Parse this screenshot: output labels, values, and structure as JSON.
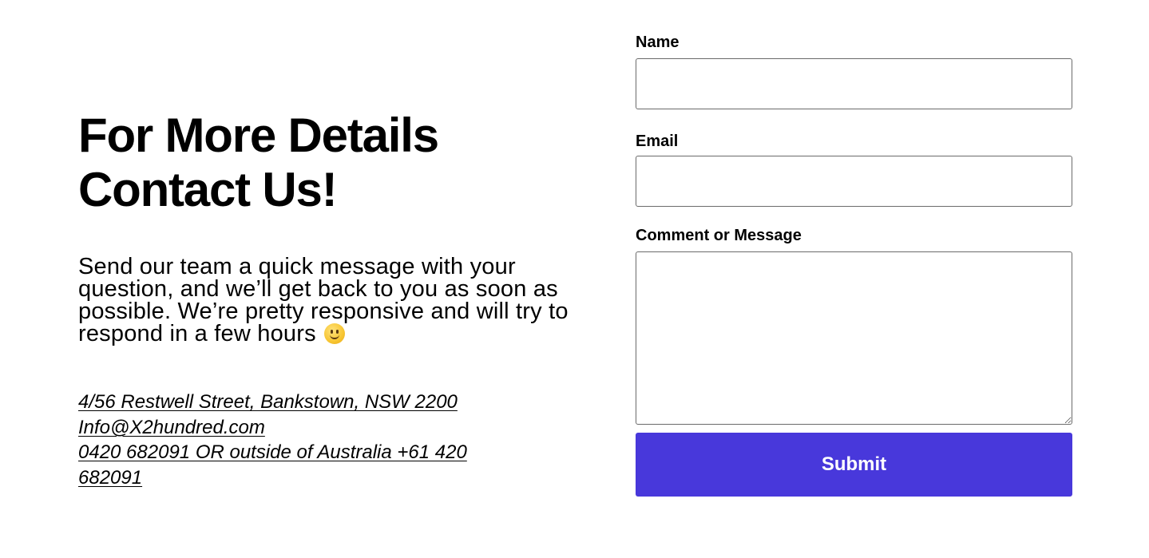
{
  "heading": {
    "line1": "For More Details",
    "line2": "Contact Us!"
  },
  "intro": {
    "text": "Send our team a quick message with your question, and we’ll get back to you as soon as possible. We’re pretty responsive and will try to respond in a few hours",
    "emoji_icon": "slightly-smiling-face-icon"
  },
  "contact": {
    "address": "4/56 Restwell Street, Bankstown, NSW 2200",
    "email": "Info@X2hundred.com",
    "phone": "0420 682091 OR outside of Australia +61 420 682091"
  },
  "form": {
    "name_label": "Name",
    "name_value": "",
    "email_label": "Email",
    "email_value": "",
    "message_label": "Comment or Message",
    "message_value": "",
    "submit_label": "Submit"
  },
  "colors": {
    "submit_background": "#4838db",
    "submit_text": "#ffffff",
    "field_border": "#6b6b6b"
  }
}
